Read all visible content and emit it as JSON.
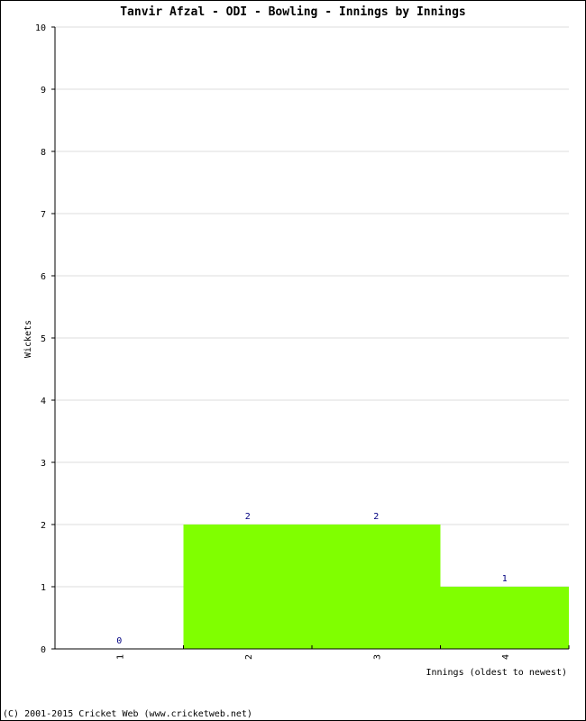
{
  "chart_data": {
    "type": "bar",
    "title": "Tanvir Afzal - ODI - Bowling - Innings by Innings",
    "xlabel": "Innings (oldest to newest)",
    "ylabel": "Wickets",
    "categories": [
      "1",
      "2",
      "3",
      "4"
    ],
    "values": [
      0,
      2,
      2,
      1
    ],
    "ylim": [
      0,
      10
    ],
    "yticks": [
      0,
      1,
      2,
      3,
      4,
      5,
      6,
      7,
      8,
      9,
      10
    ],
    "grid": true,
    "bar_color": "#80ff00",
    "label_color": "#000080",
    "grid_color": "#dddddd"
  },
  "footer": "(C) 2001-2015 Cricket Web (www.cricketweb.net)"
}
